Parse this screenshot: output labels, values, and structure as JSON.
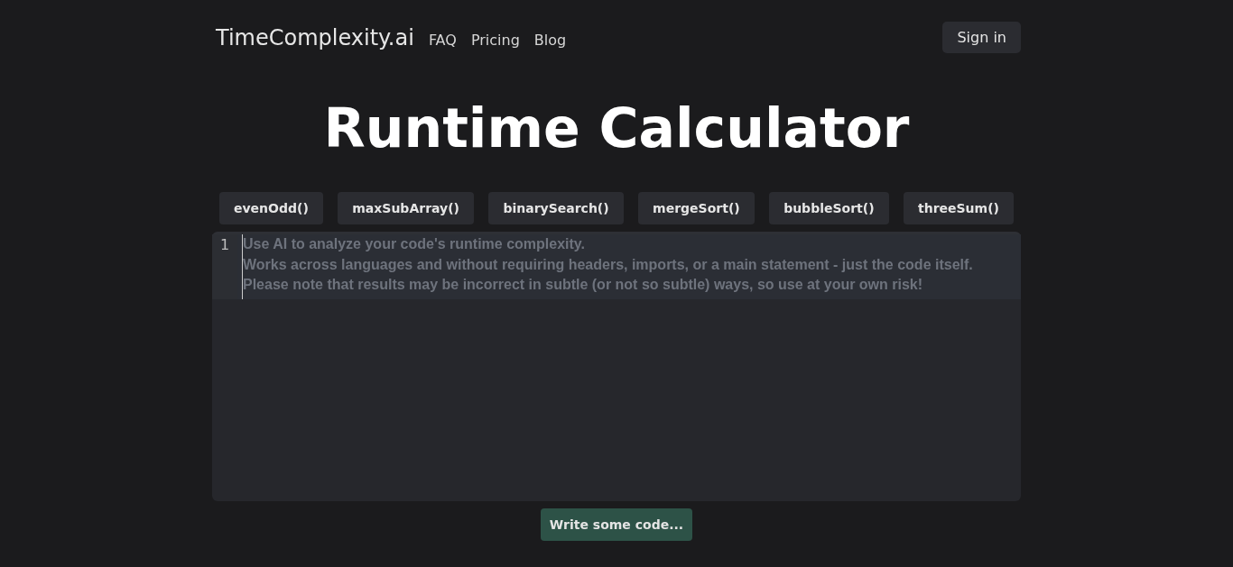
{
  "header": {
    "logo": "TimeComplexity.ai",
    "nav": [
      "FAQ",
      "Pricing",
      "Blog"
    ],
    "sign_in": "Sign in"
  },
  "title": "Runtime Calculator",
  "examples": [
    "evenOdd()",
    "maxSubArray()",
    "binarySearch()",
    "mergeSort()",
    "bubbleSort()",
    "threeSum()"
  ],
  "editor": {
    "line_number": "1",
    "placeholder": "Use AI to analyze your code's runtime complexity.\nWorks across languages and without requiring headers, imports, or a main statement - just the code itself.\nPlease note that results may be incorrect in subtle (or not so subtle) ways, so use at your own risk!"
  },
  "submit": {
    "label": "Write some code...",
    "disabled": true
  }
}
